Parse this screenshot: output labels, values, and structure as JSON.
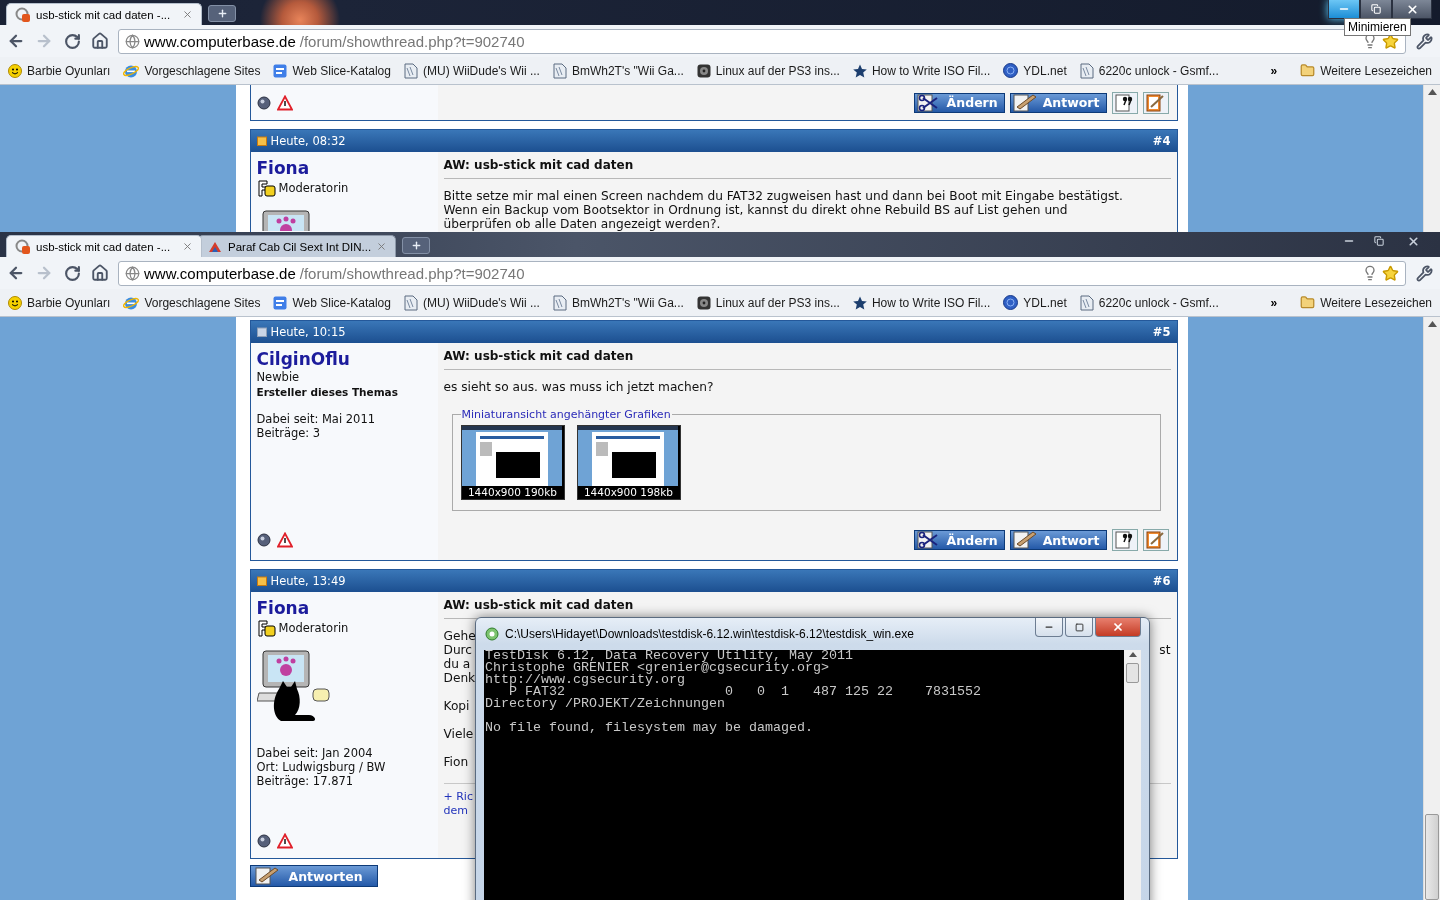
{
  "back_browser": {
    "tabs": [
      {
        "title": "usb-stick mit cad daten -...",
        "selected": true
      }
    ],
    "address": {
      "host": "www.computerbase.de",
      "path": "/forum/showthread.php?t=902740"
    },
    "bookmarks": [
      {
        "label": "Barbie Oyunları",
        "kind": "smiley"
      },
      {
        "label": "Vorgeschlagene Sites",
        "kind": "ie"
      },
      {
        "label": "Web Slice-Katalog",
        "kind": "webslice"
      },
      {
        "label": "(MU) WiiDude's Wii ...",
        "kind": "page"
      },
      {
        "label": "BmWh2T's \"Wii Ga...",
        "kind": "page"
      },
      {
        "label": "Linux auf der PS3 ins...",
        "kind": "disc"
      },
      {
        "label": "How to Write ISO Fil...",
        "kind": "star"
      },
      {
        "label": "YDL.net",
        "kind": "globe"
      },
      {
        "label": "6220c unlock - Gsmf...",
        "kind": "page"
      }
    ],
    "overflow": "»",
    "other_bookmarks": "Weitere Lesezeichen",
    "tooltip": "Minimieren",
    "previous_post_actions": [
      "Ändern",
      "Antwort"
    ],
    "posts": [
      {
        "date": "Heute, 08:32",
        "number": "#4",
        "new": true,
        "author": "Fiona",
        "rank": "Moderatorin",
        "moderator": true,
        "avatar": true,
        "title": "AW: usb-stick mit cad daten",
        "paragraphs": [
          {
            "lines": [
              {
                "text": "Bitte setze mir mal einen Screen nachdem du FAT32 zugweisen hast und dann bei Boot mit Eingabe bestätigst."
              },
              {
                "text": "Wenn ein Backup vom Bootsektor in Ordnung ist, kannst du direkt ohne Rebuild BS auf List gehen und"
              },
              {
                "text": "überprüfen ob alle Daten angezeigt werden?."
              }
            ]
          }
        ]
      }
    ]
  },
  "front_browser": {
    "tabs": [
      {
        "title": "usb-stick mit cad daten -...",
        "selected": true
      },
      {
        "title": "Paraf Cab Cil Sext Int DIN...",
        "selected": false
      }
    ],
    "address": {
      "host": "www.computerbase.de",
      "path": "/forum/showthread.php?t=902740"
    },
    "bookmarks": [
      {
        "label": "Barbie Oyunları",
        "kind": "smiley"
      },
      {
        "label": "Vorgeschlagene Sites",
        "kind": "ie"
      },
      {
        "label": "Web Slice-Katalog",
        "kind": "webslice"
      },
      {
        "label": "(MU) WiiDude's Wii ...",
        "kind": "page"
      },
      {
        "label": "BmWh2T's \"Wii Ga...",
        "kind": "page"
      },
      {
        "label": "Linux auf der PS3 ins...",
        "kind": "disc"
      },
      {
        "label": "How to Write ISO Fil...",
        "kind": "star"
      },
      {
        "label": "YDL.net",
        "kind": "globe"
      },
      {
        "label": "6220c unlock - Gsmf...",
        "kind": "page"
      }
    ],
    "overflow": "»",
    "other_bookmarks": "Weitere Lesezeichen",
    "posts": [
      {
        "date": "Heute, 10:15",
        "number": "#5",
        "new": false,
        "author": "CilginOflu",
        "rank": "Newbie",
        "moderator": false,
        "starter_note": "Ersteller dieses Themas",
        "avatar": false,
        "details": [
          "Dabei seit: Mai 2011",
          "Beiträge: 3"
        ],
        "title": "AW: usb-stick mit cad daten",
        "paragraphs": [
          {
            "lines": [
              {
                "text": "es sieht so aus. was muss ich jetzt machen?"
              }
            ]
          }
        ],
        "attachments": {
          "legend": "Miniaturansicht angehängter Grafiken",
          "items": [
            "1440x900 190kb",
            "1440x900 198kb"
          ]
        },
        "actions": [
          "Ändern",
          "Antwort"
        ]
      },
      {
        "date": "Heute, 13:49",
        "number": "#6",
        "new": true,
        "author": "Fiona",
        "rank": "Moderatorin",
        "moderator": true,
        "avatar": true,
        "details": [
          "Dabei seit: Jan 2004",
          "Ort: Ludwigsburg / BW",
          "Beiträge: 17.871"
        ],
        "title": "AW: usb-stick mit cad daten",
        "paragraphs": [
          {
            "lines": [
              {
                "text": "Gehe"
              },
              {
                "text": "Durc",
                "tail": "st"
              },
              {
                "text": "du a"
              },
              {
                "text": "Denk"
              }
            ]
          },
          {
            "lines": [
              {
                "text": "Kopi"
              }
            ]
          },
          {
            "lines": [
              {
                "text": "Viele"
              }
            ]
          },
          {
            "lines": [
              {
                "text": "Fion"
              }
            ]
          }
        ],
        "links": [
          "+ Ric",
          "dem"
        ]
      }
    ],
    "reply_button": "Antworten"
  },
  "console": {
    "title": "C:\\Users\\Hidayet\\Downloads\\testdisk-6.12.win\\testdisk-6.12\\testdisk_win.exe",
    "blocks": [
      [
        "TestDisk 6.12, Data Recovery Utility, May 2011",
        "Christophe GRENIER <grenier@cgsecurity.org>",
        "http://www.cgsecurity.org",
        "   P FAT32                    0   0  1   487 125 22    7831552",
        "Directory /PROJEKT/Zeichnungen"
      ],
      [
        "No file found, filesystem may be damaged."
      ]
    ]
  }
}
